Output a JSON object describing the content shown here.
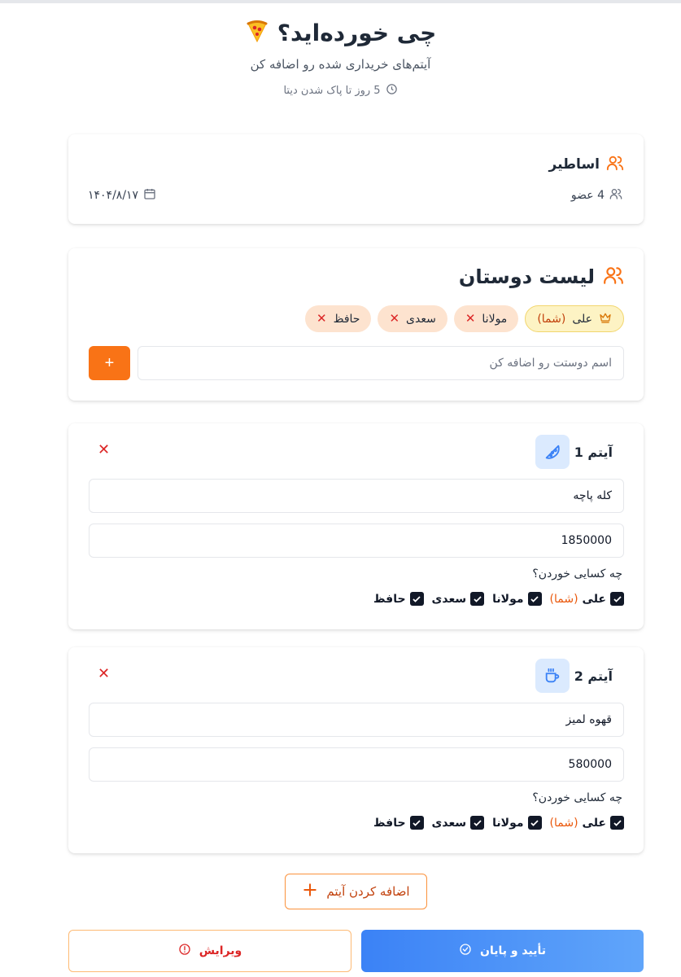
{
  "header": {
    "title": "چی خورده‌اید؟",
    "title_icon": "pizza-icon",
    "subtitle": "آیتم‌های خریداری شده رو اضافه کن",
    "expiry_text": "5 روز تا پاک شدن دیتا",
    "expiry_icon": "clock-icon"
  },
  "group": {
    "name": "اساطیر",
    "members_text": "4 عضو",
    "date": "۱۴۰۴/۸/۱۷"
  },
  "friends": {
    "title": "لیست دوستان",
    "owner": {
      "name": "علی",
      "you_label": "(شما)",
      "icon": "crown-icon"
    },
    "others": [
      "مولانا",
      "سعدی",
      "حافظ"
    ],
    "input_placeholder": "اسم دوستت رو اضافه کن",
    "add_button_label": "+"
  },
  "items": [
    {
      "title": "آیتم 1",
      "icon": "pizza-slice-icon",
      "name_value": "کله پاچه",
      "price_value": "1850000",
      "who_label": "چه کسایی خوردن؟",
      "eaters": [
        {
          "name": "علی",
          "you_label": "(شما)",
          "checked": true
        },
        {
          "name": "مولانا",
          "checked": true
        },
        {
          "name": "سعدی",
          "checked": true
        },
        {
          "name": "حافظ",
          "checked": true
        }
      ]
    },
    {
      "title": "آیتم 2",
      "icon": "coffee-cup-icon",
      "name_value": "قهوه لمیز",
      "price_value": "580000",
      "who_label": "چه کسایی خوردن؟",
      "eaters": [
        {
          "name": "علی",
          "you_label": "(شما)",
          "checked": true
        },
        {
          "name": "مولانا",
          "checked": true
        },
        {
          "name": "سعدی",
          "checked": true
        },
        {
          "name": "حافظ",
          "checked": true
        }
      ]
    }
  ],
  "actions": {
    "add_item_label": "اضافه کردن آیتم",
    "edit_label": "ویرایش",
    "confirm_label": "تأیید و پایان"
  },
  "colors": {
    "accent": "#f97316",
    "primary_blue": "#3b82f6",
    "danger": "#dc2626"
  }
}
